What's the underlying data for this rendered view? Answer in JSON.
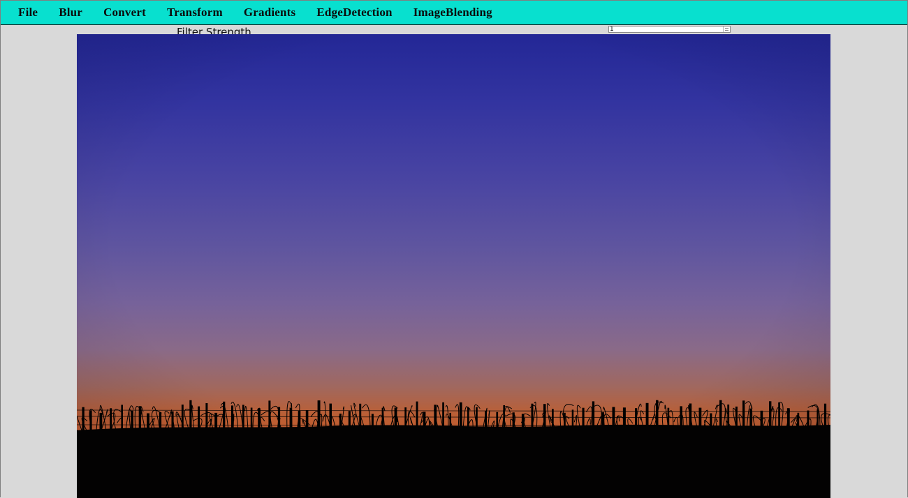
{
  "menubar": {
    "items": [
      {
        "label": "File"
      },
      {
        "label": "Blur"
      },
      {
        "label": "Convert"
      },
      {
        "label": "Transform"
      },
      {
        "label": "Gradients"
      },
      {
        "label": "EdgeDetection"
      },
      {
        "label": "ImageBlending"
      }
    ],
    "background": "#08e0cf"
  },
  "controls": {
    "filter_label": "Filter Strength",
    "filter_value": "1"
  },
  "image": {
    "subject": "sunset sky over field with fence silhouette",
    "colors": {
      "sky_top": "#232796",
      "sky_mid": "#5c519f",
      "sky_glow": "#a86655",
      "horizon": "#c45a2c",
      "ground": "#000000"
    }
  }
}
